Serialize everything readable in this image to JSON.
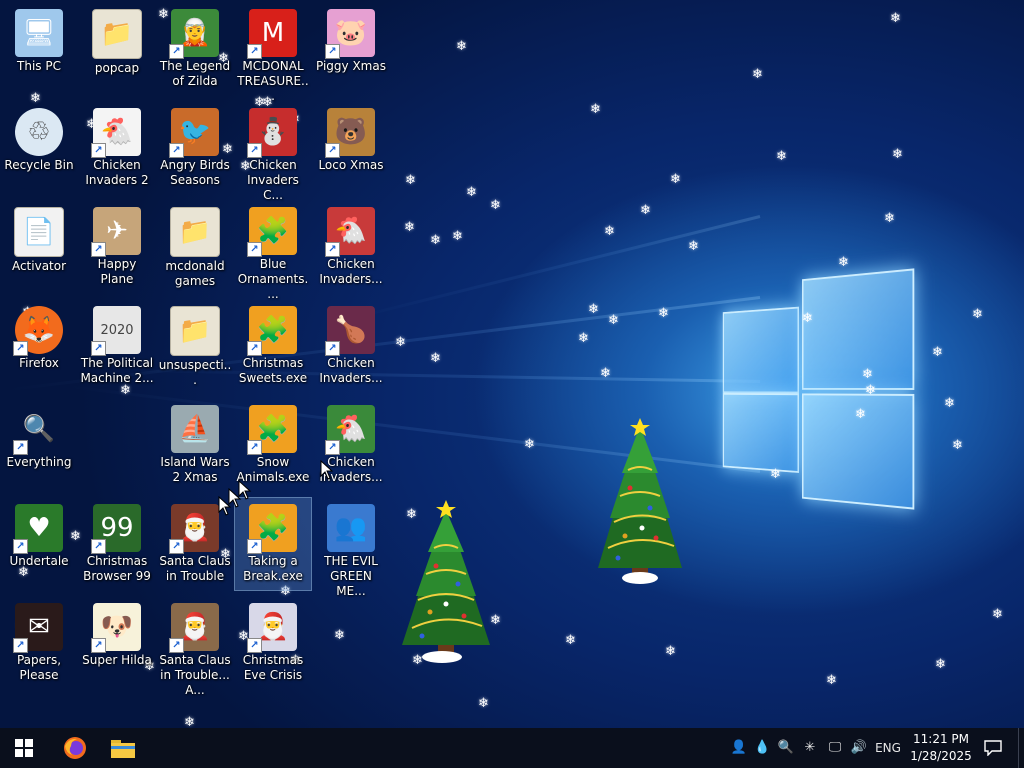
{
  "desktop_icons": [
    {
      "label": "This PC",
      "icon": "computer-icon",
      "shortcut": false,
      "color": "#9fc8ec",
      "glyph": "🖥"
    },
    {
      "label": "popcap",
      "icon": "folder-icon",
      "shortcut": false,
      "color": "#e9e4d4",
      "glyph": "📁"
    },
    {
      "label": "The Legend of Zilda",
      "icon": "game-icon",
      "shortcut": true,
      "color": "#3c8a3a",
      "glyph": "🧝"
    },
    {
      "label": "MCDONAL TREASURE...",
      "icon": "game-icon",
      "shortcut": true,
      "color": "#d8201a",
      "glyph": "M"
    },
    {
      "label": "Piggy Xmas",
      "icon": "game-icon",
      "shortcut": true,
      "color": "#e6a0d2",
      "glyph": "🐷"
    },
    {
      "label": "Recycle Bin",
      "icon": "recycle-bin-icon",
      "shortcut": false,
      "color": "#dbe8f3",
      "glyph": "♲"
    },
    {
      "label": "Chicken Invaders 2",
      "icon": "game-icon",
      "shortcut": true,
      "color": "#f4f4f4",
      "glyph": "🐔"
    },
    {
      "label": "Angry Birds Seasons",
      "icon": "game-icon",
      "shortcut": true,
      "color": "#c96b2a",
      "glyph": "🐦"
    },
    {
      "label": "Chicken Invaders C...",
      "icon": "game-icon",
      "shortcut": true,
      "color": "#c62d2d",
      "glyph": "⛄"
    },
    {
      "label": "Loco Xmas",
      "icon": "game-icon",
      "shortcut": true,
      "color": "#b8823a",
      "glyph": "🐻"
    },
    {
      "label": "Activator",
      "icon": "file-icon",
      "shortcut": false,
      "color": "#f2f2f2",
      "glyph": "📄"
    },
    {
      "label": "Happy Plane",
      "icon": "game-icon",
      "shortcut": true,
      "color": "#c6a57a",
      "glyph": "✈"
    },
    {
      "label": "mcdonald games",
      "icon": "folder-icon",
      "shortcut": false,
      "color": "#e9e4d4",
      "glyph": "📁"
    },
    {
      "label": "Blue Ornaments....",
      "icon": "game-icon",
      "shortcut": true,
      "color": "#f0a020",
      "glyph": "🧩"
    },
    {
      "label": "Chicken Invaders...",
      "icon": "game-icon",
      "shortcut": true,
      "color": "#c83a3a",
      "glyph": "🐔"
    },
    {
      "label": "Firefox",
      "icon": "firefox-icon",
      "shortcut": true,
      "color": "#f26b1d",
      "glyph": "🦊"
    },
    {
      "label": "The Political Machine 2...",
      "icon": "game-icon",
      "shortcut": true,
      "color": "#e7e7e7",
      "glyph": "2020"
    },
    {
      "label": "unsuspecti...",
      "icon": "folder-icon",
      "shortcut": false,
      "color": "#e9e4d4",
      "glyph": "📁"
    },
    {
      "label": "Christmas Sweets.exe",
      "icon": "game-icon",
      "shortcut": true,
      "color": "#f0a020",
      "glyph": "🧩"
    },
    {
      "label": "Chicken Invaders...",
      "icon": "game-icon",
      "shortcut": true,
      "color": "#6a2a4a",
      "glyph": "🍗"
    },
    {
      "label": "Everything",
      "icon": "search-icon",
      "shortcut": true,
      "color": "transparent",
      "glyph": "🔍"
    },
    {
      "label": "Island Wars 2 Xmas",
      "icon": "game-icon",
      "shortcut": false,
      "color": "#9aaab0",
      "glyph": "⛵"
    },
    {
      "label": "Snow Animals.exe",
      "icon": "game-icon",
      "shortcut": true,
      "color": "#f0a020",
      "glyph": "🧩"
    },
    {
      "label": "Chicken Invaders...",
      "icon": "game-icon",
      "shortcut": true,
      "color": "#3a8a3a",
      "glyph": "🐔"
    },
    {
      "label": "Undertale",
      "icon": "game-icon",
      "shortcut": true,
      "color": "#2a7a2a",
      "glyph": "♥"
    },
    {
      "label": "Christmas Browser 99",
      "icon": "game-icon",
      "shortcut": true,
      "color": "#2a6a2a",
      "glyph": "99"
    },
    {
      "label": "Santa Claus in Trouble",
      "icon": "game-icon",
      "shortcut": true,
      "color": "#7a3a2a",
      "glyph": "🎅"
    },
    {
      "label": "Taking a Break.exe",
      "icon": "game-icon",
      "shortcut": true,
      "color": "#f0a020",
      "glyph": "🧩"
    },
    {
      "label": "THE EVIL GREEN ME...",
      "icon": "game-icon",
      "shortcut": false,
      "color": "#3a7ad0",
      "glyph": "👥"
    },
    {
      "label": "Papers, Please",
      "icon": "game-icon",
      "shortcut": true,
      "color": "#2a1a1a",
      "glyph": "✉"
    },
    {
      "label": "Super Hilda",
      "icon": "game-icon",
      "shortcut": true,
      "color": "#f7f2da",
      "glyph": "🐶"
    },
    {
      "label": "Santa Claus in Trouble... A...",
      "icon": "game-icon",
      "shortcut": true,
      "color": "#8a6a4a",
      "glyph": "🎅"
    },
    {
      "label": "Christmas Eve Crisis",
      "icon": "game-icon",
      "shortcut": true,
      "color": "#d8d8e8",
      "glyph": "🎅"
    }
  ],
  "taskbar": {
    "start_icon": "windows-start-icon",
    "pinned": [
      {
        "name": "firefox-taskbar-icon"
      },
      {
        "name": "file-explorer-icon"
      }
    ],
    "tray": {
      "language": "ENG",
      "time": "11:21 PM",
      "date": "1/28/2025"
    }
  },
  "colors": {
    "taskbar_bg": "#0a0f1c",
    "wallpaper_dark": "#041540",
    "wallpaper_glow": "#3d9ee8"
  }
}
